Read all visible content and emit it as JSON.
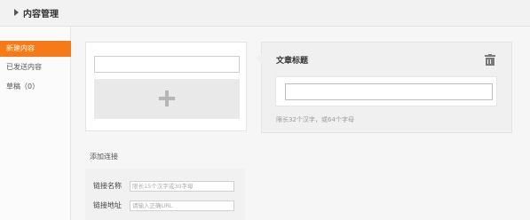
{
  "header": {
    "title": "内容管理"
  },
  "sidebar": {
    "items": [
      {
        "label": "新建内容",
        "active": true
      },
      {
        "label": "已发送内容",
        "active": false
      },
      {
        "label": "草稿（0）",
        "active": false
      }
    ]
  },
  "editor": {
    "title_value": "",
    "image_add_icon": "plus-icon"
  },
  "form": {
    "label": "文章标题",
    "delete_icon": "trash-icon",
    "title_value": "",
    "hint": "限长32个汉字，或64个字母"
  },
  "links": {
    "section_label": "添加连接",
    "name_label": "链接名称",
    "name_placeholder": "限长15个汉字或30字母",
    "url_label": "链接地址",
    "url_placeholder": "请输入正确URL"
  },
  "colors": {
    "accent": "#f57b18"
  }
}
